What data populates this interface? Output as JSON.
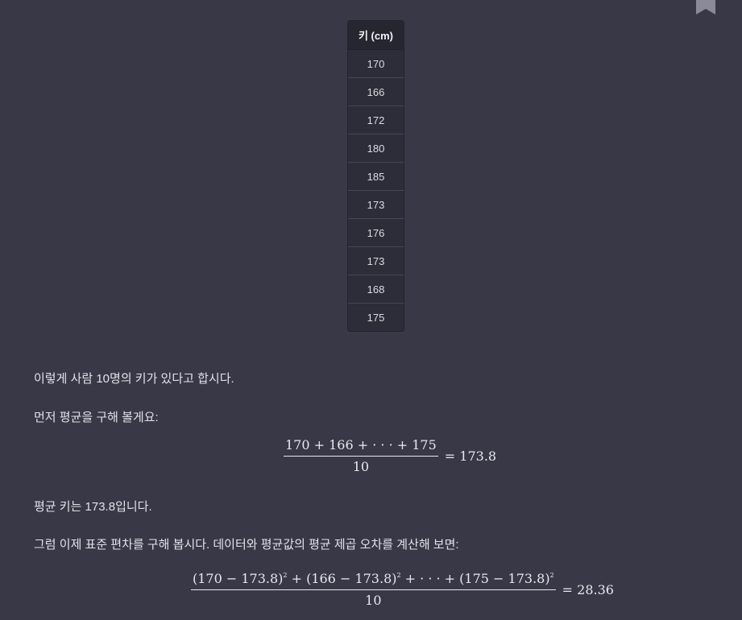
{
  "table": {
    "header": "키 (cm)",
    "rows": [
      "170",
      "166",
      "172",
      "180",
      "185",
      "173",
      "176",
      "173",
      "168",
      "175"
    ]
  },
  "paragraphs": {
    "p1": "이렇게 사람 10명의 키가 있다고 합시다.",
    "p2": "먼저 평균을 구해 볼게요:",
    "p3": "평균 키는 173.8입니다.",
    "p4": "그럼 이제 표준 편차를 구해 봅시다. 데이터와 평균값의 평균 제곱 오차를 계산해 보면:"
  },
  "formula_mean": {
    "numerator": "170 + 166 + · · · + 175",
    "denominator": "10",
    "result": "= 173.8"
  },
  "formula_variance": {
    "term1": "(170 − 173.8)",
    "term2": " + (166 − 173.8)",
    "term3": " + · · · + (175 − 173.8)",
    "exponent": "2",
    "denominator": "10",
    "result": "= 28.36"
  },
  "icons": {
    "bookmark": "bookmark-icon"
  },
  "colors": {
    "background": "#383847",
    "table_header": "#262630",
    "table_body": "#2d2d39",
    "text": "#e2e2ea",
    "bookmark": "#8a8a98"
  }
}
